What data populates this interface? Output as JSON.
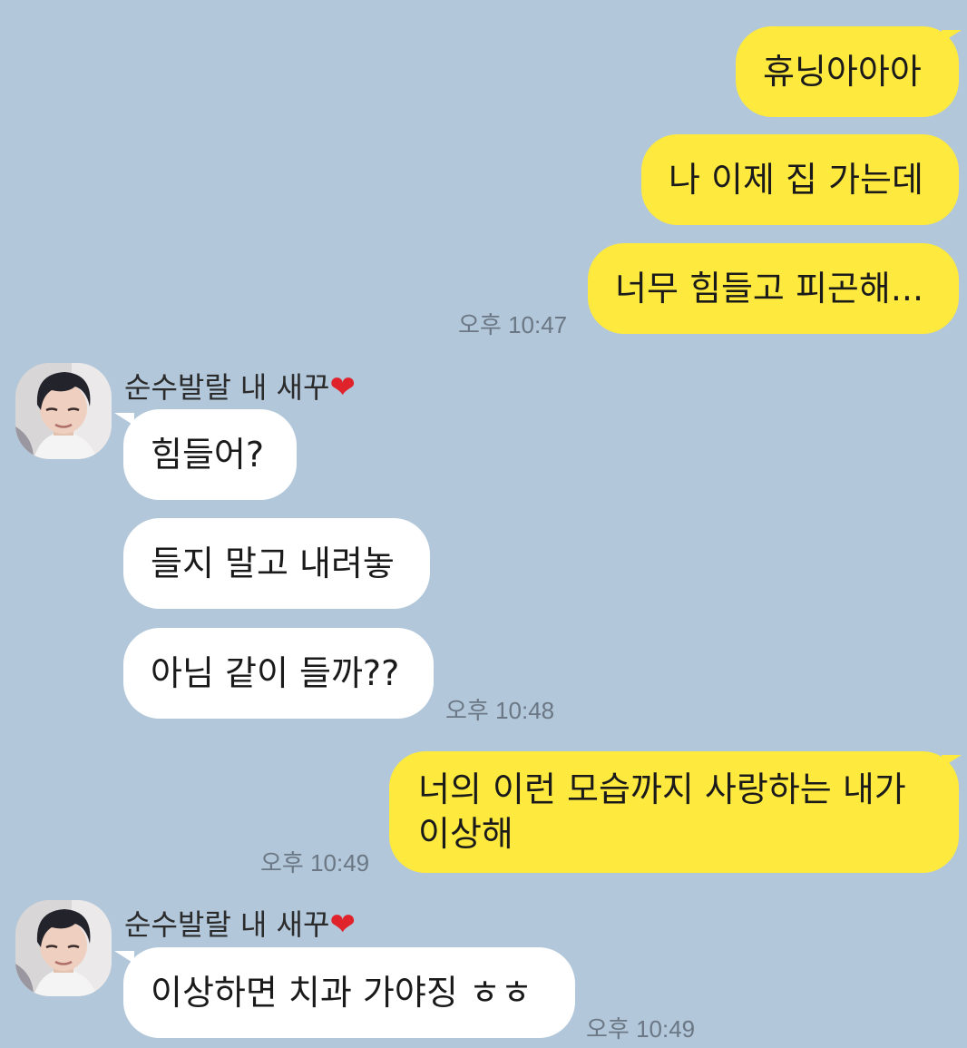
{
  "messages": {
    "m1": "휴닝아아아",
    "m2": "나 이제 집 가는데",
    "m3": "너무 힘들고 피곤해...",
    "m3_time": "오후 10:47",
    "sender1": "순수발랄 내 새꾸",
    "sender1_emoji": "❤",
    "r1": "힘들어?",
    "r2": "들지 말고 내려놓",
    "r3": "아님 같이 들까??",
    "r3_time": "오후 10:48",
    "m4_line1": "너의 이런 모습까지 사랑하는 내가",
    "m4_line2": "이상해",
    "m4_time": "오후 10:49",
    "sender2": "순수발랄 내 새꾸",
    "sender2_emoji": "❤",
    "r4": "이상하면 치과 가야징 ㅎㅎ",
    "r4_time": "오후 10:49"
  },
  "colors": {
    "background": "#b2c7da",
    "my_bubble": "#fee93f",
    "their_bubble": "#ffffff"
  },
  "icons": {
    "avatar": "profile-photo",
    "heart": "red-heart-emoji"
  }
}
